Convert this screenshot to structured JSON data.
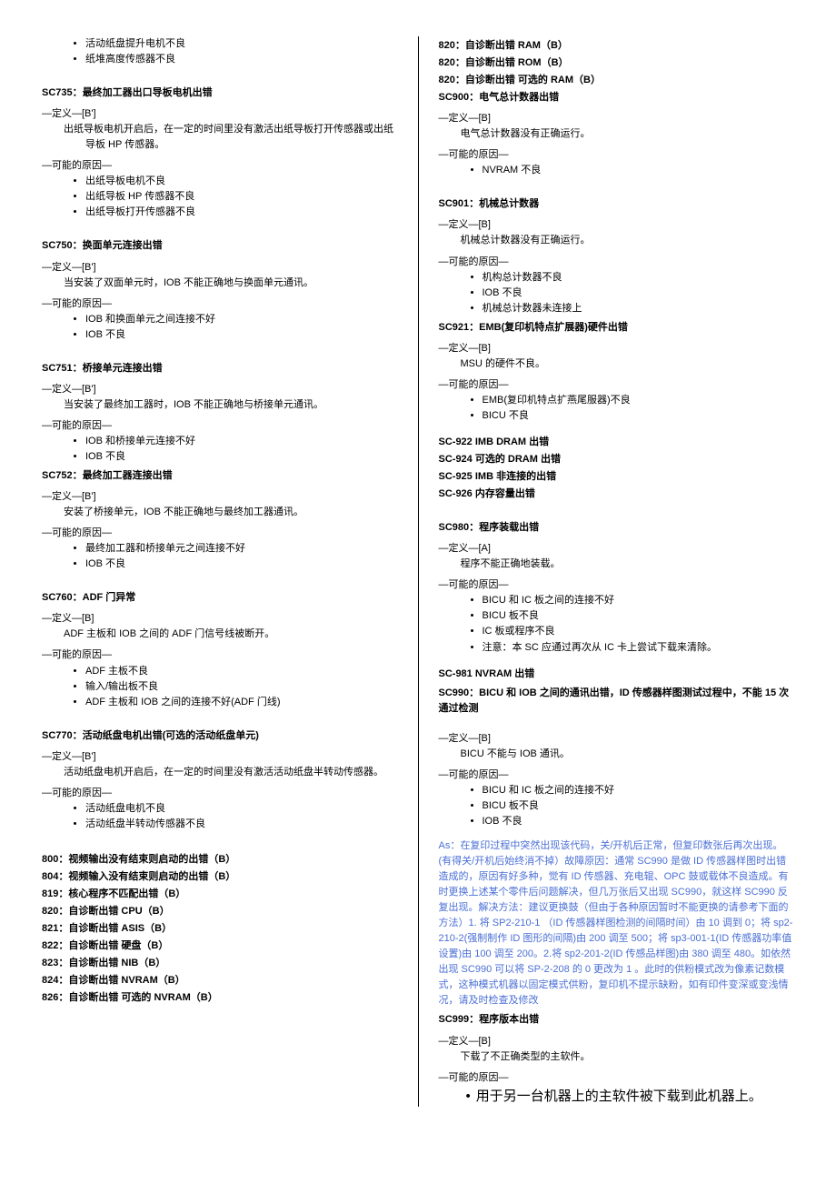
{
  "left": {
    "top_bullets": [
      "活动纸盘提升电机不良",
      "纸堆高度传感器不良"
    ],
    "sc735_head": "SC735：最终加工器出口导板电机出错",
    "sc735_def_label": "—定义—[B']",
    "sc735_def": "出纸导板电机开启后，在一定的时间里没有激活出纸导板打开传感器或出纸导板 HP 传感器。",
    "sc735_cause_label": "—可能的原因—",
    "sc735_causes": [
      "出纸导板电机不良",
      "出纸导板 HP 传感器不良",
      "出纸导板打开传感器不良"
    ],
    "sc750_head": "SC750：换面单元连接出错",
    "sc750_def_label": "—定义—[B']",
    "sc750_def": "当安装了双面单元时，IOB 不能正确地与换面单元通讯。",
    "sc750_cause_label": "—可能的原因—",
    "sc750_causes": [
      "IOB 和换面单元之间连接不好",
      "IOB 不良"
    ],
    "sc751_head": "SC751：桥接单元连接出错",
    "sc751_def_label": "—定义—[B']",
    "sc751_def": "当安装了最终加工器时，IOB 不能正确地与桥接单元通讯。",
    "sc751_cause_label": "—可能的原因—",
    "sc751_causes": [
      "IOB 和桥接单元连接不好",
      "IOB 不良"
    ],
    "sc752_head": "SC752：最终加工器连接出错",
    "sc752_def_label": "—定义—[B']",
    "sc752_def": "安装了桥接单元，IOB 不能正确地与最终加工器通讯。",
    "sc752_cause_label": "—可能的原因—",
    "sc752_causes": [
      "最终加工器和桥接单元之间连接不好",
      "IOB 不良"
    ],
    "sc760_head": "SC760：ADF 门异常",
    "sc760_def_label": "—定义—[B]",
    "sc760_def": "ADF 主板和 IOB 之间的 ADF 门信号线被断开。",
    "sc760_cause_label": "—可能的原因—",
    "sc760_causes": [
      "ADF 主板不良",
      "输入/输出板不良",
      "ADF 主板和 IOB 之间的连接不好(ADF 门线)"
    ],
    "sc770_head": "SC770：活动纸盘电机出错(可选的活动纸盘单元)",
    "sc770_def_label": "—定义—[B']",
    "sc770_def": "活动纸盘电机开启后，在一定的时间里没有激活活动纸盘半转动传感器。",
    "sc770_cause_label": "—可能的原因—",
    "sc770_causes": [
      "活动纸盘电机不良",
      "活动纸盘半转动传感器不良"
    ],
    "codes800": [
      "800：视频输出没有结束则启动的出错（B）",
      "804：视频输入没有结束则启动的出错（B）",
      "819：核心程序不匹配出错（B）",
      "820：自诊断出错  CPU（B）",
      "821：自诊断出错  ASIS（B）",
      "822：自诊断出错  硬盘（B）",
      "823：自诊断出错  NIB（B）",
      "824：自诊断出错 NVRAM（B）",
      "826：自诊断出错  可选的 NVRAM（B）"
    ]
  },
  "right": {
    "top820": [
      "820：自诊断出错  RAM（B）",
      "820：自诊断出错  ROM（B）",
      "820：自诊断出错  可选的 RAM（B）",
      "SC900：电气总计数器出错"
    ],
    "sc900_def_label": "—定义—[B]",
    "sc900_def": "电气总计数器没有正确运行。",
    "sc900_cause_label": "—可能的原因—",
    "sc900_causes": [
      "NVRAM 不良"
    ],
    "sc901_head": "SC901：机械总计数器",
    "sc901_def_label": "—定义—[B]",
    "sc901_def": "机械总计数器没有正确运行。",
    "sc901_cause_label": "—可能的原因—",
    "sc901_causes": [
      "机构总计数器不良",
      "IOB 不良",
      "机械总计数器未连接上"
    ],
    "sc921_head": "SC921：EMB(复印机特点扩展器)硬件出错",
    "sc921_def_label": "—定义—[B]",
    "sc921_def": "MSU 的硬件不良。",
    "sc921_cause_label": "—可能的原因—",
    "sc921_causes": [
      "EMB(复印机特点扩燕尾服器)不良",
      "BICU 不良"
    ],
    "sc922block": [
      "SC-922 IMB DRAM 出错",
      "SC-924  可选的 DRAM 出错",
      "SC-925 IMB 非连接的出错",
      "SC-926  内存容量出错"
    ],
    "sc980_head": "SC980：程序装载出错",
    "sc980_def_label": "—定义—[A]",
    "sc980_def": "程序不能正确地装载。",
    "sc980_cause_label": "—可能的原因—",
    "sc980_causes": [
      "BICU 和 IC 板之间的连接不好",
      "BICU 板不良",
      "IC 板或程序不良",
      "注意：本 SC 应通过再次从 IC 卡上尝试下载来清除。"
    ],
    "sc981_head": "SC-981 NVRAM 出错",
    "sc990_head": "SC990：BICU 和 IOB 之间的通讯出错，ID 传感器样图测试过程中，不能 15 次通过检测",
    "sc990_def_label": "—定义—[B]",
    "sc990_def": "BICU 不能与 IOB 通讯。",
    "sc990_cause_label": "—可能的原因—",
    "sc990_causes": [
      "BICU 和 IC 板之间的连接不好",
      "BICU 板不良",
      "IOB 不良"
    ],
    "blue_note": "As：在复印过程中突然出现该代码，关/开机后正常，但复印数张后再次出现。(有得关/开机后始终消不掉）故障原因：通常 SC990 是做 ID 传感器样图时出错造成的，原因有好多种，觉有 ID 传感器、充电辊、OPC 鼓或载体不良造成。有时更换上述某个零件后问题解决，但几万张后又出现 SC990，就这样 SC990 反复出现。解决方法：建议更换鼓（但由于各种原因暂时不能更换的请参考下面的方法）1. 将 SP2-210-1 （ID 传感器样图检测的间隔时间）由 10 调到 0；将 sp2-210-2(强制制作 ID 图形的间隔)由 200 调至 500；将 sp3-001-1(ID 传感器功率值设置)由 100 调至 200。2.将 sp2-201-2(ID 传感品样图)由 380 调至 480。如依然出现 SC990  可以将 SP-2-208  的 0 更改为 1 。此时的供粉模式改为像素记数模式，这种模式机器以固定模式供粉，复印机不提示缺粉，如有印件变深或变浅情况，请及时检查及修改",
    "sc999_head": "SC999：程序版本出错",
    "sc999_def_label": "—定义—[B]",
    "sc999_def": "下载了不正确类型的主软件。",
    "sc999_cause_label": "—可能的原因—",
    "sc999_cause_big": "用于另一台机器上的主软件被下载到此机器上。"
  }
}
